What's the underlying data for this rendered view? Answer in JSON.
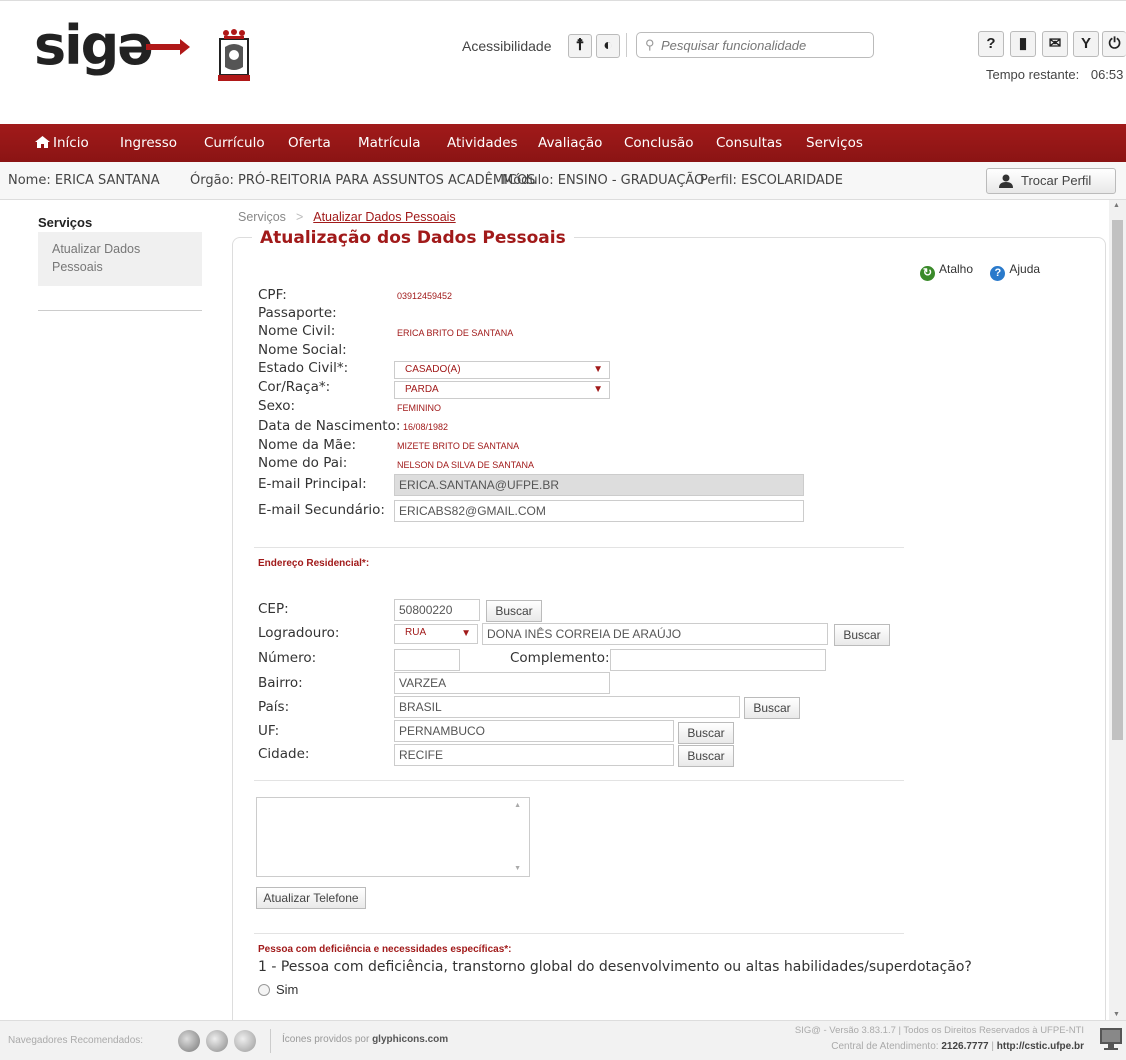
{
  "header": {
    "logo_text": "sigə",
    "accessibility_label": "Acessibilidade",
    "search_placeholder": "Pesquisar funcionalidade",
    "timer_label": "Tempo restante:",
    "timer_value": "06:53"
  },
  "nav": {
    "items": [
      {
        "label": "Início"
      },
      {
        "label": "Ingresso"
      },
      {
        "label": "Currículo"
      },
      {
        "label": "Oferta"
      },
      {
        "label": "Matrícula"
      },
      {
        "label": "Atividades"
      },
      {
        "label": "Avaliação"
      },
      {
        "label": "Conclusão"
      },
      {
        "label": "Consultas"
      },
      {
        "label": "Serviços"
      }
    ]
  },
  "infobar": {
    "nome": "Nome: ERICA SANTANA",
    "orgao": "Órgão: PRÓ-REITORIA PARA ASSUNTOS ACADÊMICOS",
    "modulo": "Módulo: ENSINO - GRADUAÇÃO",
    "perfil": "Perfil: ESCOLARIDADE",
    "trocar_label": "Trocar Perfil"
  },
  "sidebar": {
    "title": "Serviços",
    "item": "Atualizar Dados Pessoais"
  },
  "breadcrumb": {
    "root": "Serviços",
    "current": "Atualizar Dados Pessoais"
  },
  "panel": {
    "title": "Atualização dos Dados Pessoais",
    "atalho": "Atalho",
    "ajuda": "Ajuda"
  },
  "fields": {
    "cpf_label": "CPF:",
    "cpf": "03912459452",
    "passaporte_label": "Passaporte:",
    "nome_civil_label": "Nome Civil:",
    "nome_civil": "ERICA BRITO DE SANTANA",
    "nome_social_label": "Nome Social:",
    "estado_civil_label": "Estado Civil*:",
    "estado_civil": "CASADO(A)",
    "cor_label": "Cor/Raça*:",
    "cor": "PARDA",
    "sexo_label": "Sexo:",
    "sexo": "FEMININO",
    "nascimento_label": "Data de Nascimento:",
    "nascimento": "16/08/1982",
    "mae_label": "Nome da Mãe:",
    "mae": "MIZETE BRITO DE SANTANA",
    "pai_label": "Nome do Pai:",
    "pai": "NELSON DA SILVA DE SANTANA",
    "email_principal_label": "E-mail Principal:",
    "email_principal": "ERICA.SANTANA@UFPE.BR",
    "email_secundario_label": "E-mail Secundário:",
    "email_secundario": "ERICABS82@GMAIL.COM"
  },
  "endereco": {
    "section": "Endereço Residencial*:",
    "cep_label": "CEP:",
    "cep": "50800220",
    "logradouro_label": "Logradouro:",
    "tipo": "RUA",
    "logradouro": "DONA INÊS CORREIA DE ARAÚJO",
    "numero_label": "Número:",
    "numero": "",
    "complemento_label": "Complemento:",
    "complemento": "",
    "bairro_label": "Bairro:",
    "bairro": "VARZEA",
    "pais_label": "País:",
    "pais": "BRASIL",
    "uf_label": "UF:",
    "uf": "PERNAMBUCO",
    "cidade_label": "Cidade:",
    "cidade": "RECIFE",
    "buscar": "Buscar"
  },
  "telefone": {
    "button": "Atualizar Telefone"
  },
  "deficiencia": {
    "section": "Pessoa com deficiência e necessidades específicas*:",
    "question": "1 - Pessoa com deficiência, transtorno global do desenvolvimento ou altas habilidades/superdotação?",
    "option_sim": "Sim"
  },
  "footer": {
    "navegadores": "Navegadores Recomendados:",
    "icones": "Ícones providos por",
    "icones_brand": "glyphicons.com",
    "version": "SIG@ - Versão 3.83.1.7 | Todos os Direitos Reservados à UFPE-NTI",
    "central_label": "Central de Atendimento:",
    "central_phone": "2126.7777",
    "central_url": "http://cstic.ufpe.br"
  },
  "colors": {
    "brand_red": "#a11a1a",
    "nav_bg": "#8b1414"
  }
}
